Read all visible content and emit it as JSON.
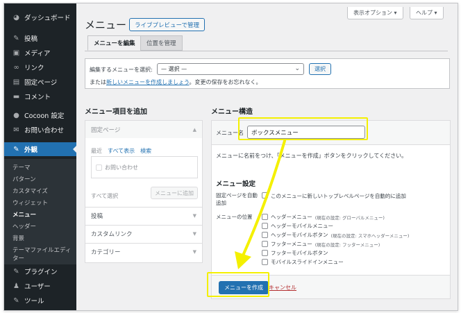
{
  "sidebar": {
    "items": [
      {
        "label": "ダッシュボード",
        "icon": "dashboard-icon",
        "glyph": "◕"
      },
      {
        "label": "投稿",
        "icon": "pin-icon",
        "glyph": "✎"
      },
      {
        "label": "メディア",
        "icon": "media-icon",
        "glyph": "▣"
      },
      {
        "label": "リンク",
        "icon": "link-icon",
        "glyph": "∞"
      },
      {
        "label": "固定ページ",
        "icon": "page-icon",
        "glyph": "▤"
      },
      {
        "label": "コメント",
        "icon": "comment-icon",
        "glyph": "▬"
      },
      {
        "label": "Cocoon 設定",
        "icon": "cocoon-icon",
        "glyph": "●"
      },
      {
        "label": "お問い合わせ",
        "icon": "mail-icon",
        "glyph": "✉"
      },
      {
        "label": "外観",
        "icon": "appearance-icon",
        "glyph": "✎"
      },
      {
        "label": "プラグイン",
        "icon": "plugin-icon",
        "glyph": "✎"
      },
      {
        "label": "ユーザー",
        "icon": "user-icon",
        "glyph": "♟"
      },
      {
        "label": "ツール",
        "icon": "tool-icon",
        "glyph": "✎"
      }
    ],
    "submenu": [
      "テーマ",
      "パターン",
      "カスタマイズ",
      "ウィジェット",
      "メニュー",
      "ヘッダー",
      "背景",
      "テーマファイルエディ",
      "ター"
    ]
  },
  "top": {
    "screen_options": "表示オプション ▾",
    "help": "ヘルプ ▾"
  },
  "header": {
    "title": "メニュー",
    "preview_button": "ライブプレビューで管理"
  },
  "tabs": [
    "メニューを編集",
    "位置を管理"
  ],
  "select_area": {
    "label": "編集するメニューを選択:",
    "selected": "— 選択 —",
    "button": "選択",
    "hint_prefix": "または",
    "hint_link": "新しいメニューを作成しましょう",
    "hint_suffix": "。変更の保存をお忘れなく。"
  },
  "left_panel": {
    "heading": "メニュー項目を追加",
    "fixed_pages": "固定ページ",
    "tab_recent": "最近",
    "tab_all": "すべて表示",
    "tab_search": "検索",
    "item": "お問い合わせ",
    "select_all": "すべて選択",
    "add_button": "メニューに追加",
    "posts": "投稿",
    "custom_links": "カスタムリンク",
    "categories": "カテゴリー"
  },
  "structure": {
    "heading": "メニュー構造",
    "name_label": "メニュー名",
    "name_value": "ボックスメニュー",
    "hint": "メニューに名前をつけ、「メニューを作成」ボタンをクリックしてください。",
    "settings_heading": "メニュー設定",
    "auto_label": "固定ページを自動追加",
    "auto_text": "このメニューに新しいトップレベルページを自動的に追加",
    "positions_label": "メニューの位置",
    "locations": [
      {
        "name": "ヘッダーメニュー",
        "note": "(現在の設定: グローバルメニュー)"
      },
      {
        "name": "ヘッダーモバイルメニュー",
        "note": ""
      },
      {
        "name": "ヘッダーモバイルボタン",
        "note": "(現在の設定: スマホヘッダーメニュー)"
      },
      {
        "name": "フッターメニュー",
        "note": "(現在の設定: フッターメニュー)"
      },
      {
        "name": "フッターモバイルボタン",
        "note": ""
      },
      {
        "name": "モバイルスライドインメニュー",
        "note": ""
      }
    ],
    "create_button": "メニューを作成",
    "cancel": "キャンセル"
  },
  "colors": {
    "highlight": "#f4f000",
    "accent": "#2271b1",
    "sidebar": "#1d2327"
  }
}
